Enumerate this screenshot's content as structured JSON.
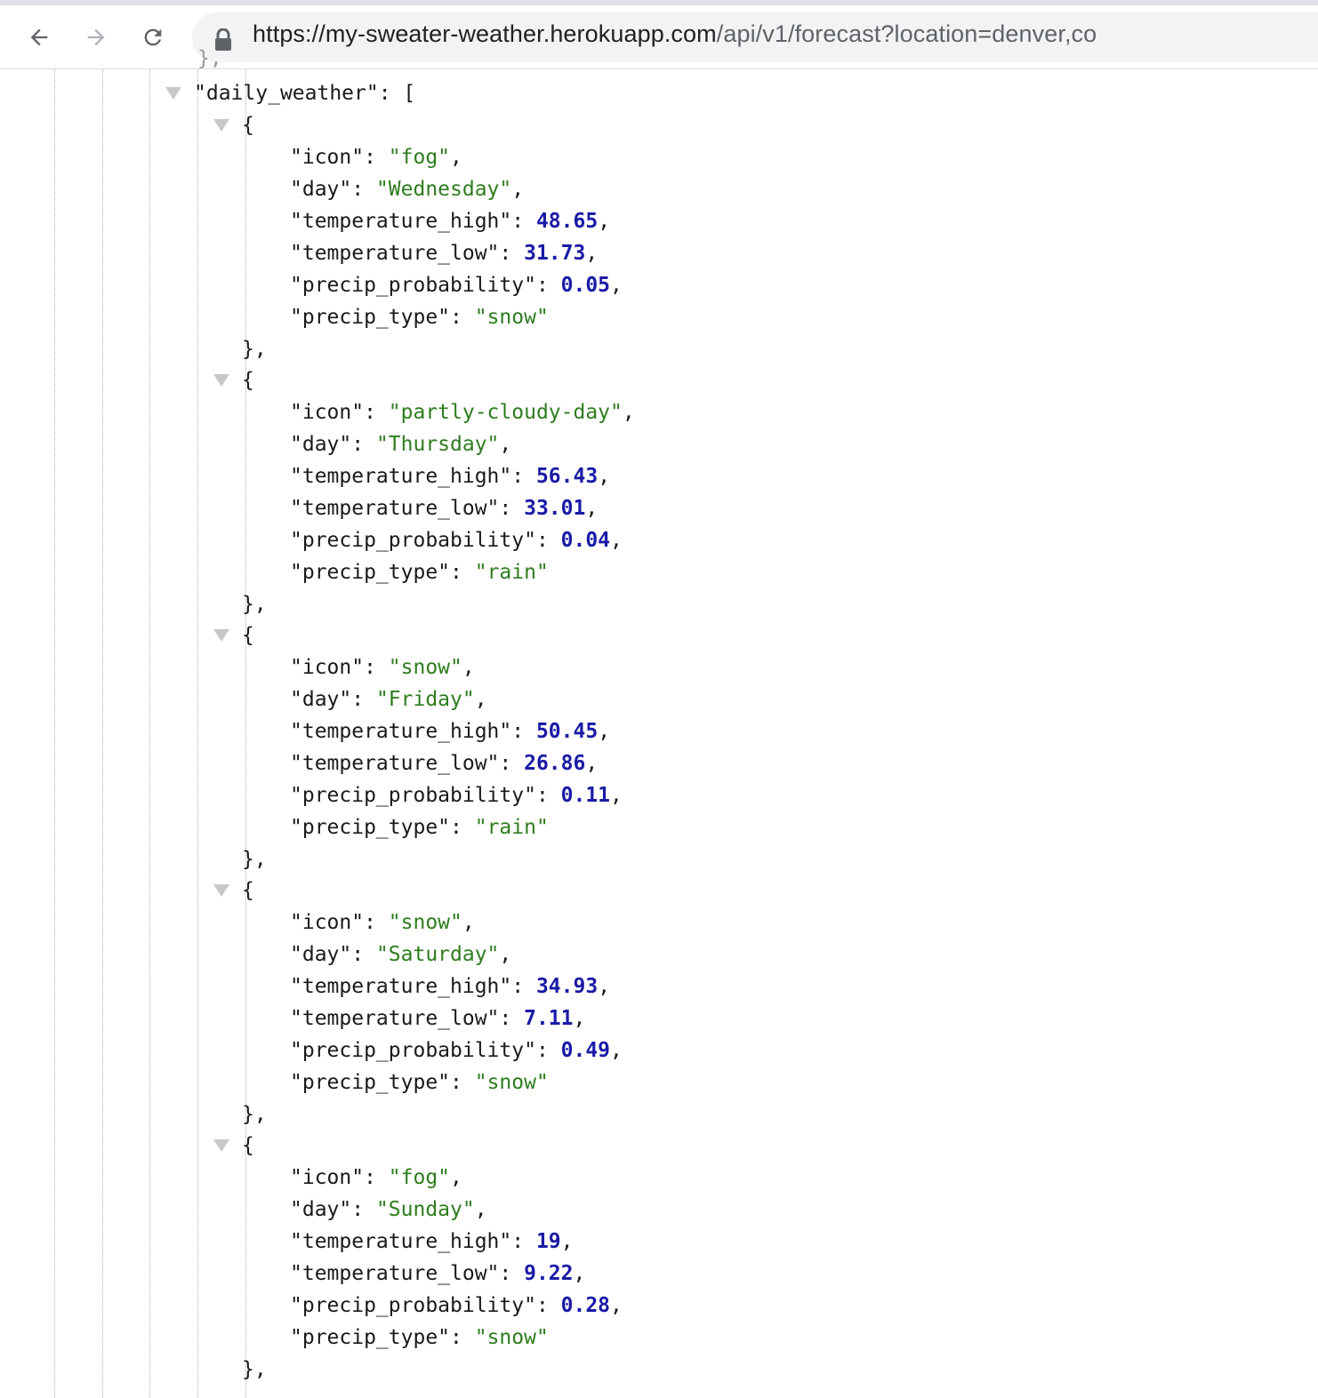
{
  "browser": {
    "url_host": "https://my-sweater-weather.herokuapp.com",
    "url_rest": "/api/v1/forecast?location=denver,co"
  },
  "json_view": {
    "array_key": "daily_weather",
    "days": [
      {
        "icon": "fog",
        "day": "Wednesday",
        "temperature_high": "48.65",
        "temperature_low": "31.73",
        "precip_probability": "0.05",
        "precip_type": "snow"
      },
      {
        "icon": "partly-cloudy-day",
        "day": "Thursday",
        "temperature_high": "56.43",
        "temperature_low": "33.01",
        "precip_probability": "0.04",
        "precip_type": "rain"
      },
      {
        "icon": "snow",
        "day": "Friday",
        "temperature_high": "50.45",
        "temperature_low": "26.86",
        "precip_probability": "0.11",
        "precip_type": "rain"
      },
      {
        "icon": "snow",
        "day": "Saturday",
        "temperature_high": "34.93",
        "temperature_low": "7.11",
        "precip_probability": "0.49",
        "precip_type": "snow"
      },
      {
        "icon": "fog",
        "day": "Sunday",
        "temperature_high": "19",
        "temperature_low": "9.22",
        "precip_probability": "0.28",
        "precip_type": "snow"
      }
    ]
  }
}
